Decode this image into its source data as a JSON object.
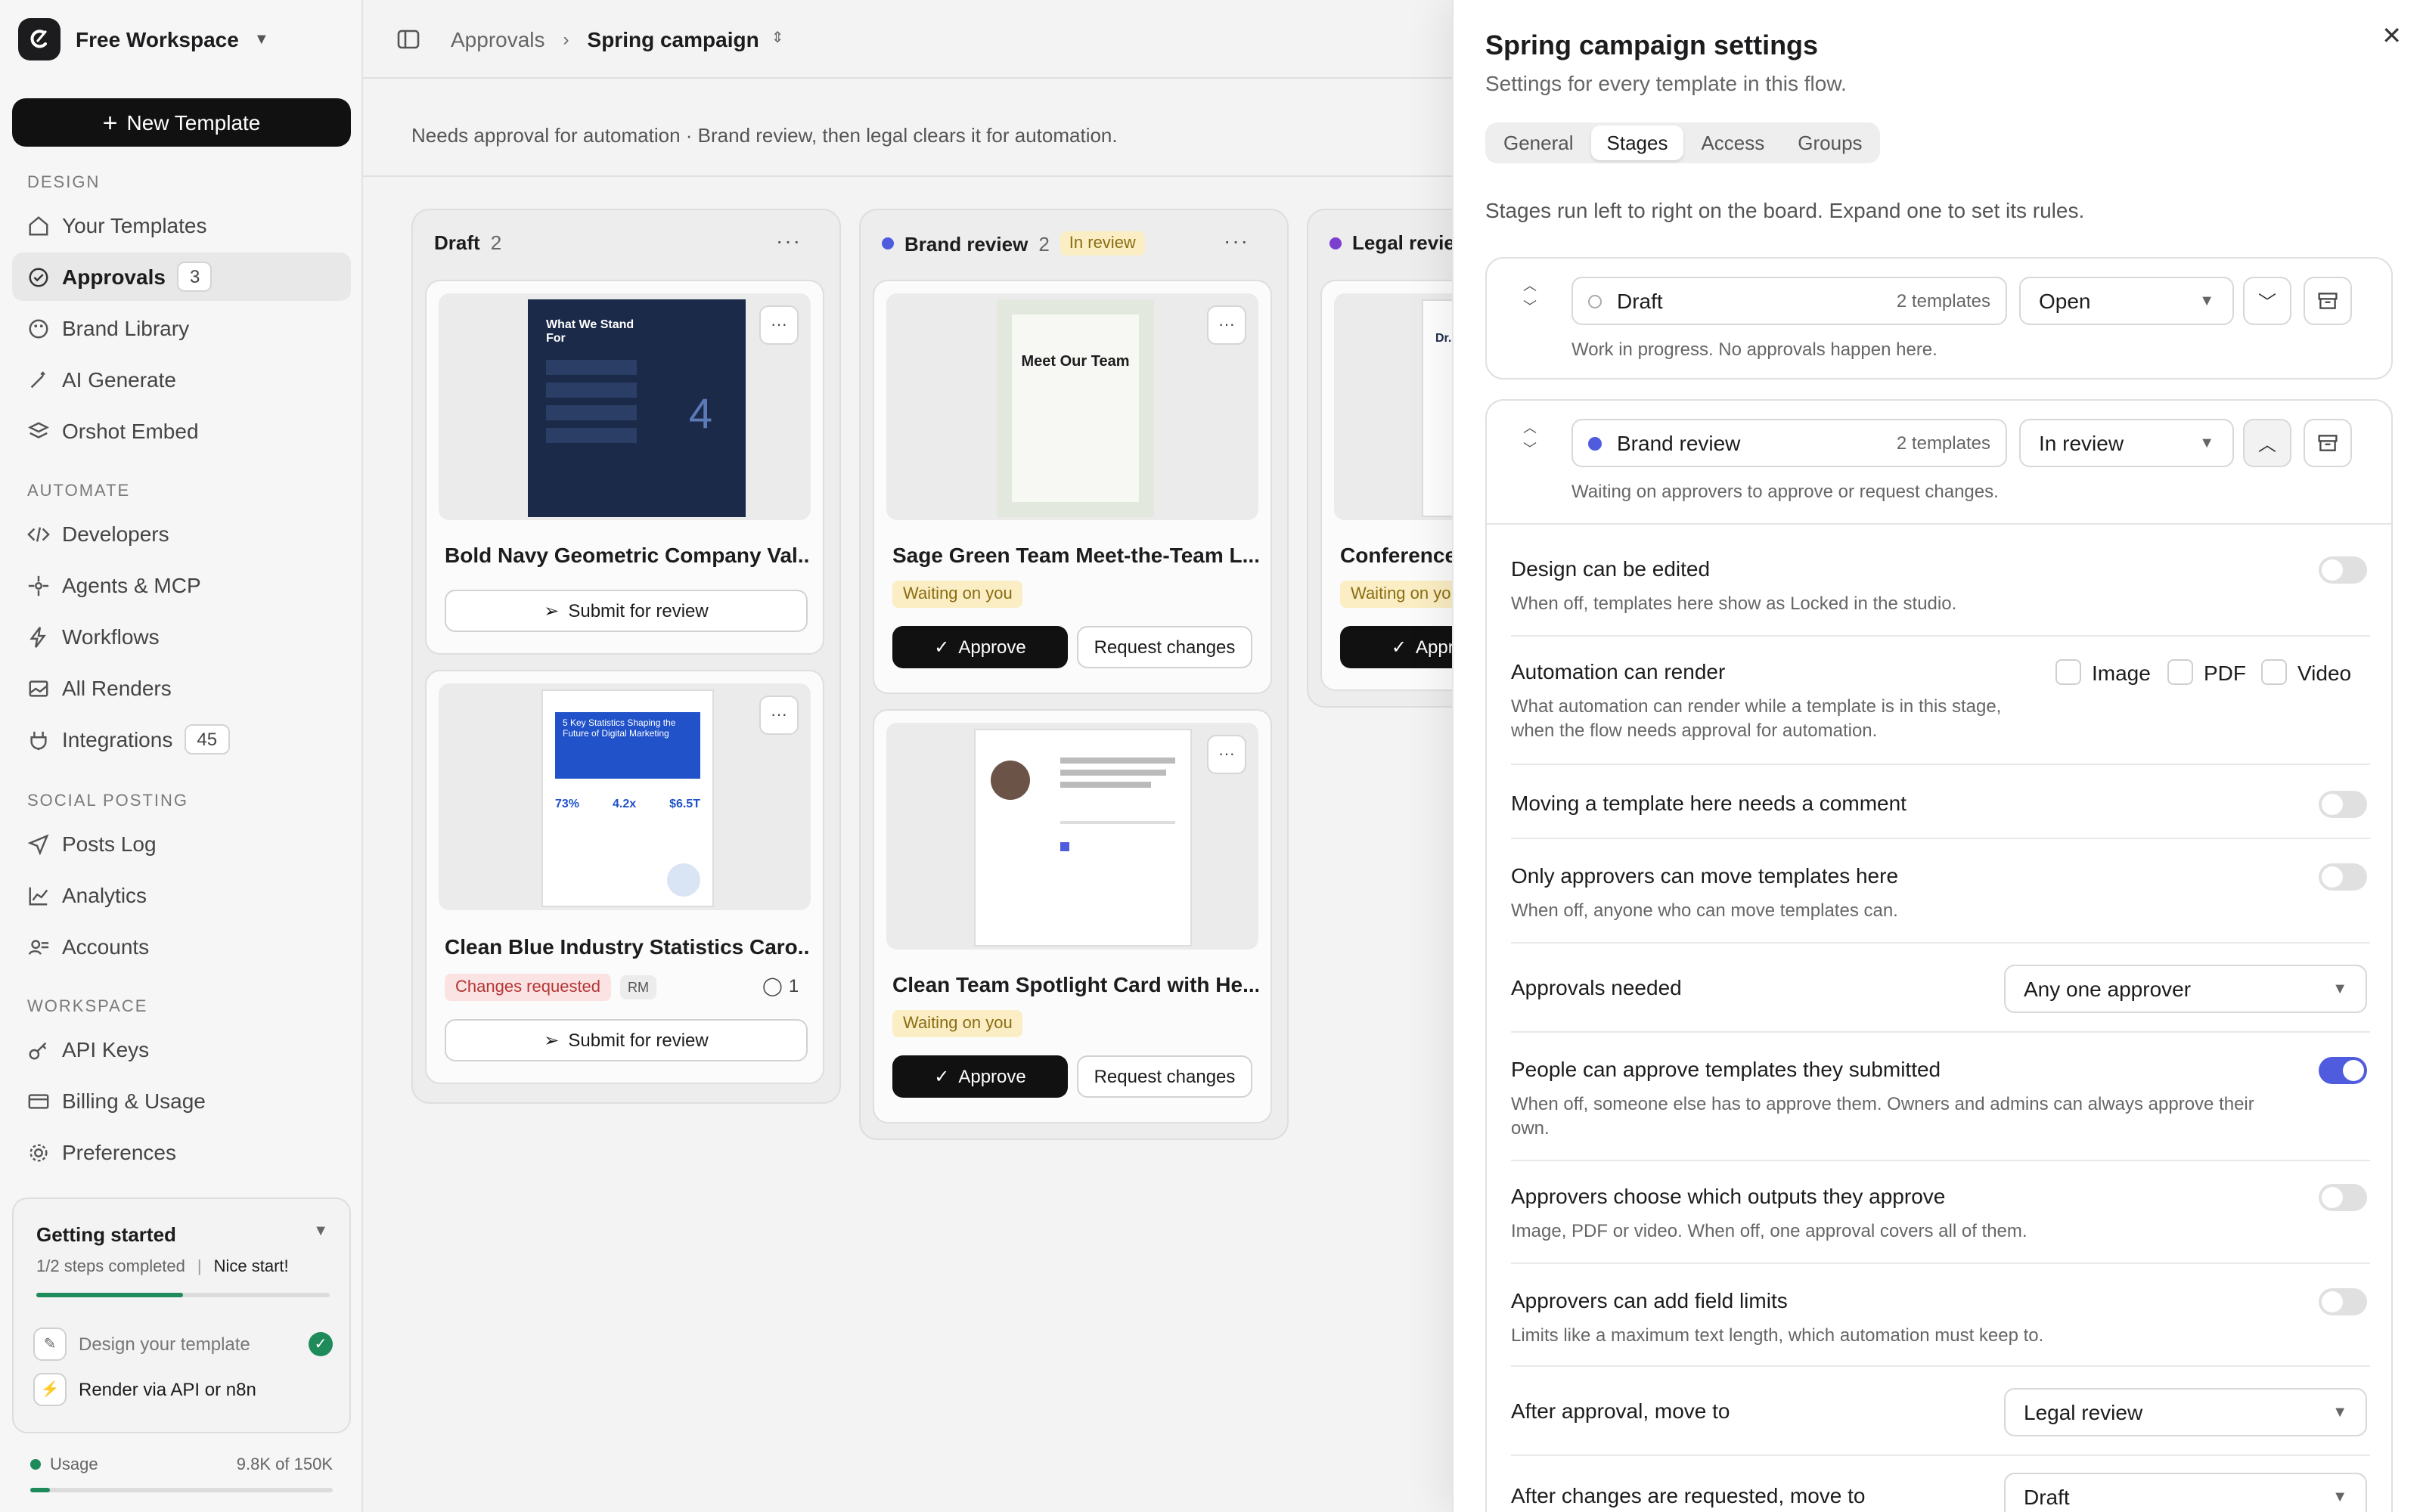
{
  "workspace": {
    "name": "Free Workspace"
  },
  "sidebar": {
    "new_template": "New Template",
    "sections": {
      "design": "DESIGN",
      "automate": "AUTOMATE",
      "social": "SOCIAL POSTING",
      "workspace": "WORKSPACE"
    },
    "items": {
      "your_templates": "Your Templates",
      "approvals": {
        "label": "Approvals",
        "count": "3"
      },
      "brand_library": "Brand Library",
      "ai_generate": "AI Generate",
      "orshot_embed": "Orshot Embed",
      "developers": "Developers",
      "agents": "Agents & MCP",
      "workflows": "Workflows",
      "all_renders": "All Renders",
      "integrations": {
        "label": "Integrations",
        "count": "45"
      },
      "posts_log": "Posts Log",
      "analytics": "Analytics",
      "accounts": "Accounts",
      "api_keys": "API Keys",
      "billing": "Billing & Usage",
      "preferences": "Preferences"
    },
    "getting_started": {
      "title": "Getting started",
      "steps": "1/2 steps completed",
      "nice": "Nice start!",
      "progress": 0.5,
      "step1": "Design your template",
      "step2": "Render via API or n8n"
    },
    "usage": {
      "label": "Usage",
      "value": "9.8K of 150K",
      "fraction": 0.065
    }
  },
  "breadcrumb": {
    "root": "Approvals",
    "current": "Spring campaign"
  },
  "flow_description": "Needs approval for automation · Brand review, then legal clears it for automation.",
  "board": {
    "draft": {
      "title": "Draft",
      "count": "2",
      "cards": [
        {
          "title": "Bold Navy Geometric Company Val...",
          "action": "Submit for review",
          "thumb_text": "What We Stand For"
        },
        {
          "title": "Clean Blue Industry Statistics Caro...",
          "badge": "Changes requested",
          "initials": "RM",
          "comments": "1",
          "action": "Submit for review",
          "thumb_text": "5 Key Statistics Shaping the Future of Digital Marketing",
          "stats": [
            "73%",
            "4.2x",
            "$6.5T"
          ]
        }
      ]
    },
    "brand": {
      "title": "Brand review",
      "count": "2",
      "status": "In review",
      "cards": [
        {
          "title": "Sage Green Team Meet-the-Team L...",
          "badge": "Waiting on you",
          "approve": "Approve",
          "request": "Request changes",
          "thumb_text": "Meet Our Team"
        },
        {
          "title": "Clean Team Spotlight Card with He...",
          "badge": "Waiting on you",
          "approve": "Approve",
          "request": "Request changes"
        }
      ]
    },
    "legal": {
      "title": "Legal revie",
      "card_title": "Conference",
      "badge": "Waiting on yo",
      "approve": "Appro",
      "thumb_text": "Dr. S Mitc"
    }
  },
  "panel": {
    "title": "Spring campaign settings",
    "subtitle": "Settings for every template in this flow.",
    "tabs": [
      "General",
      "Stages",
      "Access",
      "Groups"
    ],
    "hint": "Stages run left to right on the board. Expand one to set its rules.",
    "stages": [
      {
        "name": "Draft",
        "templates": "2 templates",
        "status": "Open",
        "desc": "Work in progress. No approvals happen here."
      },
      {
        "name": "Brand review",
        "templates": "2 templates",
        "status": "In review",
        "desc": "Waiting on approvers to approve or request changes."
      }
    ],
    "rules": {
      "edit": {
        "label": "Design can be edited",
        "desc": "When off, templates here show as Locked in the studio."
      },
      "render": {
        "label": "Automation can render",
        "desc": "What automation can render while a template is in this stage, when the flow needs approval for automation.",
        "options": [
          "Image",
          "PDF",
          "Video"
        ]
      },
      "comment": {
        "label": "Moving a template here needs a comment"
      },
      "only": {
        "label": "Only approvers can move templates here",
        "desc": "When off, anyone who can move templates can."
      },
      "needed": {
        "label": "Approvals needed",
        "value": "Any one approver"
      },
      "self": {
        "label": "People can approve templates they submitted",
        "desc": "When off, someone else has to approve them. Owners and admins can always approve their own."
      },
      "outputs": {
        "label": "Approvers choose which outputs they approve",
        "desc": "Image, PDF or video. When off, one approval covers all of them."
      },
      "limits": {
        "label": "Approvers can add field limits",
        "desc": "Limits like a maximum text length, which automation must keep to."
      },
      "after": {
        "label": "After approval, move to",
        "value": "Legal review"
      },
      "after_changes": {
        "label": "After changes are requested, move to",
        "value": "Draft"
      }
    }
  },
  "colors": {
    "accent": "#4f5cde",
    "success": "#1f8a5a",
    "warning_bg": "#fbeec4",
    "danger_bg": "#fbe3e3"
  }
}
